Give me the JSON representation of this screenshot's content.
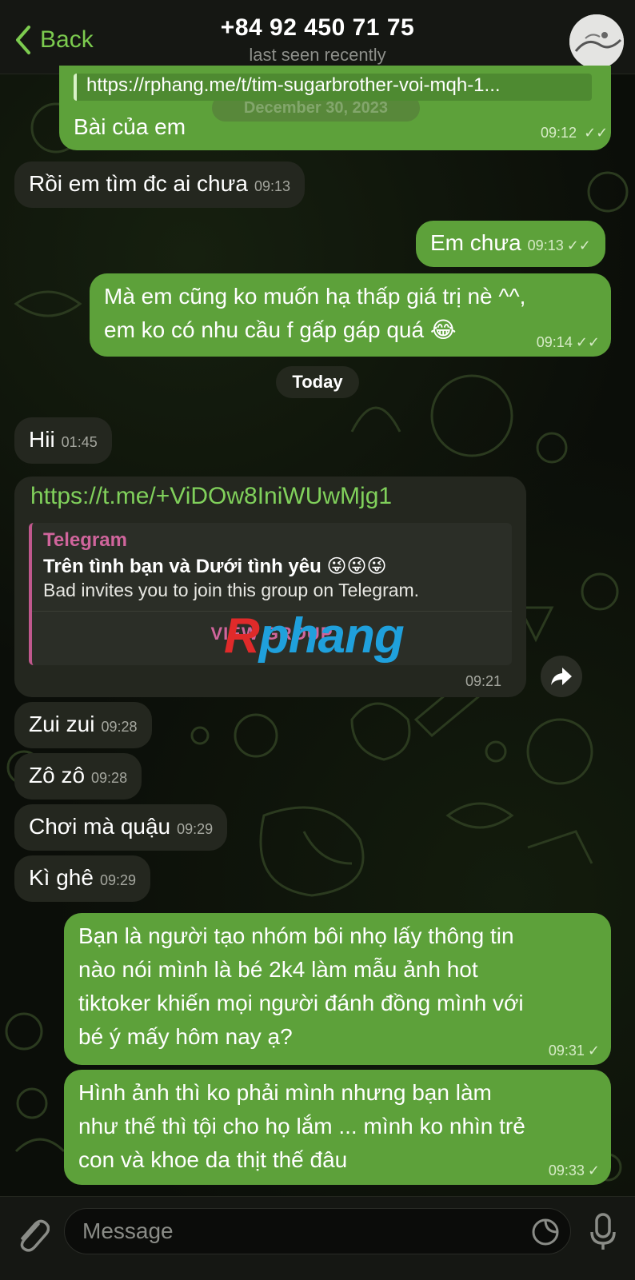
{
  "header": {
    "back_label": "Back",
    "title": "+84 92 450 71 75",
    "subtitle": "last seen recently"
  },
  "ghost_date": "December 30, 2023",
  "messages": [
    {
      "quote": "https://rphang.me/t/tim-sugarbrother-voi-mqh-1...",
      "text": "Bài của em",
      "time": "09:12",
      "status": "read"
    },
    {
      "text": "Rồi em tìm đc ai chưa",
      "time": "09:13"
    },
    {
      "text": "Em chưa",
      "time": "09:13",
      "status": "read"
    },
    {
      "line1": "Mà em cũng ko muốn hạ thấp giá trị nè ^^,",
      "line2": "em ko có nhu cầu f gấp gáp quá 😂",
      "time": "09:14",
      "status": "read"
    },
    {
      "text": "Hii",
      "time": "01:45"
    },
    {
      "link": "https://t.me/+ViDOw8IniWUwMjg1",
      "preview_site": "Telegram",
      "preview_title": "Trên tình bạn và Dưới tình yêu 😜😜😜",
      "preview_desc": "Bad invites you to join this group on Telegram.",
      "preview_button": "VIEW GROUP",
      "time": "09:21"
    },
    {
      "text": "Zui zui",
      "time": "09:28"
    },
    {
      "text": "Zô zô",
      "time": "09:28"
    },
    {
      "text": "Chơi mà quậu",
      "time": "09:29"
    },
    {
      "text": "Kì ghê",
      "time": "09:29"
    },
    {
      "lines": [
        "Bạn là người tạo nhóm bôi nhọ lấy thông tin",
        "nào nói mình là bé 2k4 làm mẫu ảnh hot",
        "tiktoker khiến mọi người đánh đồng mình với",
        "bé ý mấy hôm nay ạ?"
      ],
      "time": "09:31",
      "status": "sent"
    },
    {
      "lines": [
        "Hình ảnh thì ko phải mình nhưng bạn làm",
        "như thế thì tội cho họ lắm ... mình ko nhìn trẻ",
        "con và khoe da thịt thế đâu"
      ],
      "time": "09:33",
      "status": "sent"
    }
  ],
  "date_separator": "Today",
  "watermark": {
    "first": "R",
    "rest": "phang"
  },
  "ticks": {
    "read": "✓✓",
    "sent": "✓"
  },
  "input": {
    "placeholder": "Message"
  },
  "colors": {
    "outgoing": "#5da13a",
    "incoming": "#24271f",
    "accent": "#7ccb4f",
    "link_preview": "#d0659c"
  }
}
